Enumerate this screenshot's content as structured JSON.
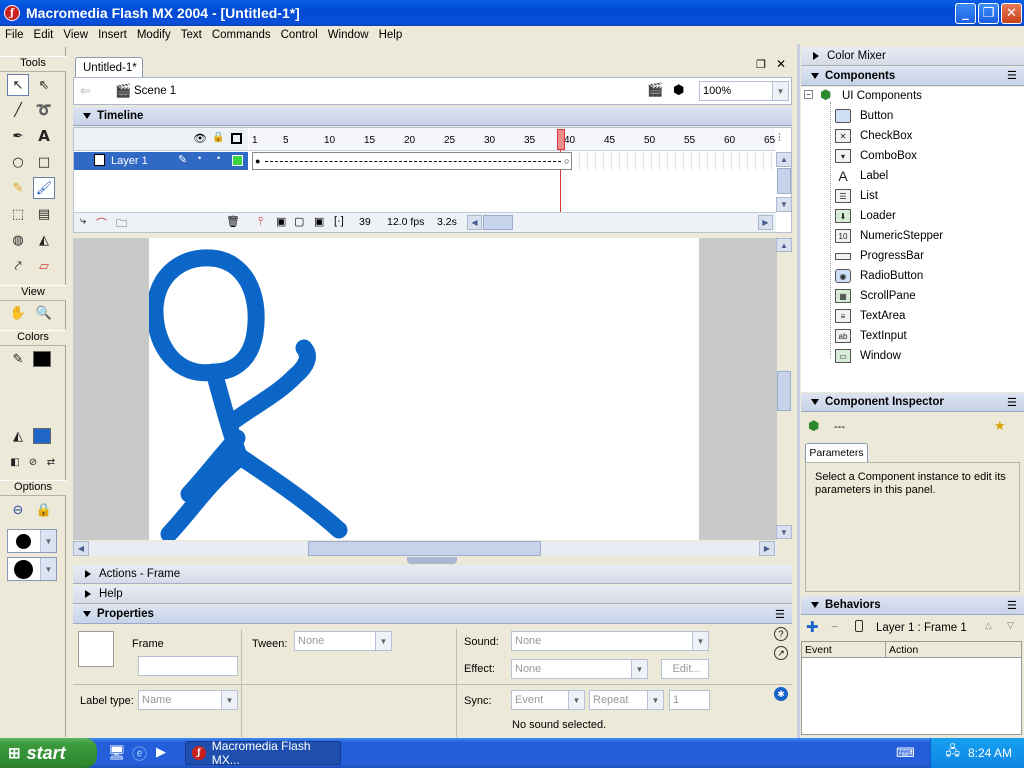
{
  "window": {
    "title": "Macromedia Flash MX 2004 - [Untitled-1*]"
  },
  "menu": [
    "File",
    "Edit",
    "View",
    "Insert",
    "Modify",
    "Text",
    "Commands",
    "Control",
    "Window",
    "Help"
  ],
  "tools": {
    "title": "Tools",
    "view_label": "View",
    "colors_label": "Colors",
    "options_label": "Options"
  },
  "document": {
    "tab": "Untitled-1*",
    "scene": "Scene 1",
    "zoom": "100%"
  },
  "timeline": {
    "title": "Timeline",
    "ruler": [
      "1",
      "5",
      "10",
      "15",
      "20",
      "25",
      "30",
      "35",
      "40",
      "45",
      "50",
      "55",
      "60",
      "65"
    ],
    "layer": "Layer 1",
    "current_frame": "39",
    "fps": "12.0 fps",
    "time": "3.2s"
  },
  "panels": {
    "actions": "Actions - Frame",
    "help": "Help",
    "properties": "Properties"
  },
  "properties": {
    "frame_label": "Frame",
    "tween_label": "Tween:",
    "tween_value": "None",
    "sound_label": "Sound:",
    "sound_value": "None",
    "effect_label": "Effect:",
    "effect_value": "None",
    "edit_button": "Edit...",
    "label_type_label": "Label type:",
    "label_type_value": "Name",
    "sync_label": "Sync:",
    "sync_event": "Event",
    "sync_repeat": "Repeat",
    "sync_count": "1",
    "no_sound": "No sound selected."
  },
  "right": {
    "color_mixer": "Color Mixer",
    "components": "Components",
    "ui_components": "UI Components",
    "component_list": [
      "Button",
      "CheckBox",
      "ComboBox",
      "Label",
      "List",
      "Loader",
      "NumericStepper",
      "ProgressBar",
      "RadioButton",
      "ScrollPane",
      "TextArea",
      "TextInput",
      "Window"
    ],
    "inspector": "Component Inspector",
    "inspector_value": "---",
    "parameters_tab": "Parameters",
    "inspector_msg": "Select a Component instance to edit its parameters in this panel.",
    "behaviors": "Behaviors",
    "behaviors_target": "Layer 1 : Frame 1",
    "col_event": "Event",
    "col_action": "Action"
  },
  "taskbar": {
    "start": "start",
    "task": "Macromedia Flash MX...",
    "clock": "8:24 AM"
  },
  "colors": {
    "stroke": "#0b66c8",
    "selection": "#316ac5",
    "playhead": "#d9383a"
  }
}
